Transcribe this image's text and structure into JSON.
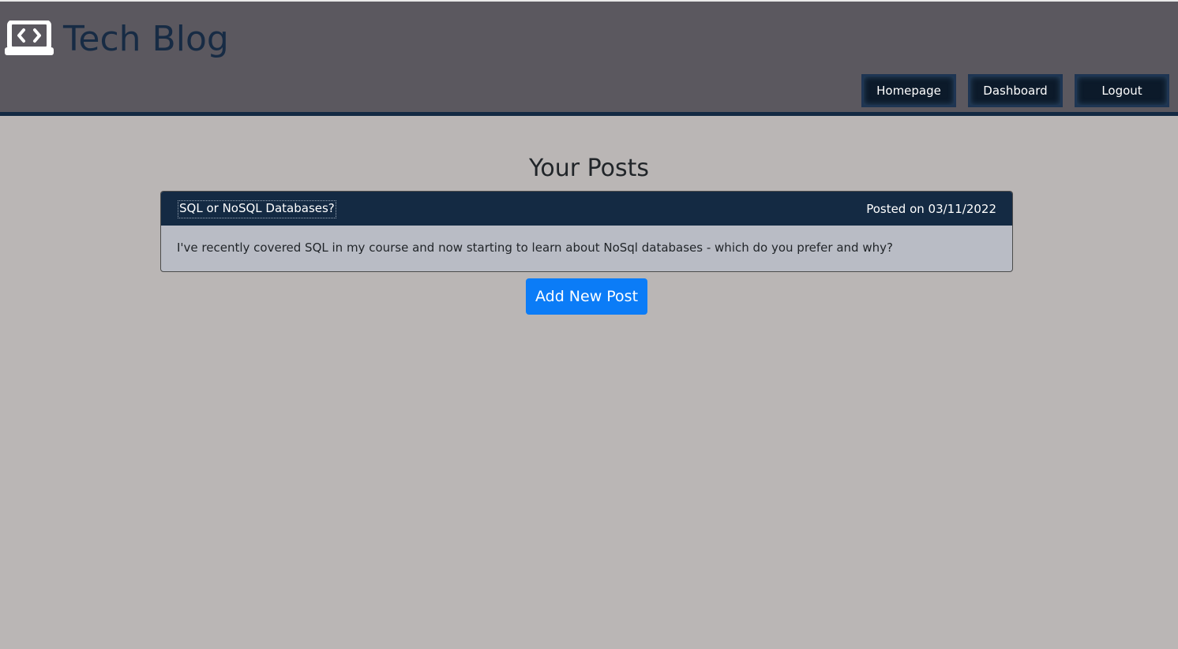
{
  "header": {
    "logo_icon": "laptop-code-icon",
    "title": "Tech Blog",
    "background_color": "#5b585f",
    "accent_color": "#142a43",
    "nav": {
      "homepage_label": "Homepage",
      "dashboard_label": "Dashboard",
      "logout_label": "Logout"
    }
  },
  "main": {
    "heading": "Your Posts",
    "posts": [
      {
        "title": "SQL or NoSQL Databases?",
        "posted": "Posted on 03/11/2022",
        "body": "I've recently covered SQL in my course and now starting to learn about NoSql databases - which do you prefer and why?"
      }
    ],
    "add_button_label": "Add New Post",
    "add_button_color": "#0b7cf7"
  }
}
